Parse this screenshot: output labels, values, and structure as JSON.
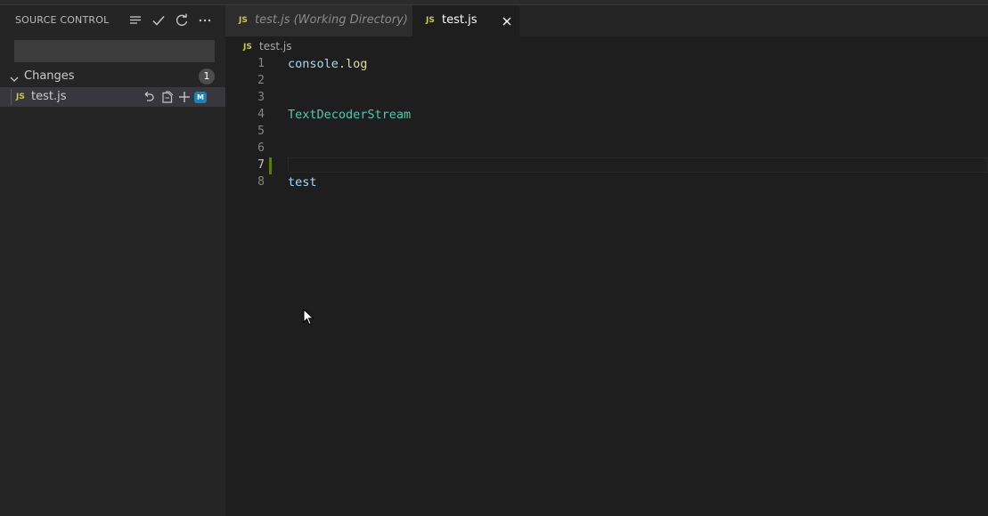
{
  "sidebar": {
    "title": "SOURCE CONTROL",
    "commit_placeholder": "",
    "changes": {
      "label": "Changes",
      "count": "1",
      "files": [
        {
          "icon": "JS",
          "name": "test.js",
          "status": "M"
        }
      ]
    },
    "header_icons": [
      "view-as-tree-icon",
      "commit-check-icon",
      "refresh-icon",
      "more-actions-icon"
    ],
    "row_icons": [
      "discard-changes-icon",
      "open-file-icon",
      "stage-changes-icon"
    ]
  },
  "tabs": [
    {
      "icon": "JS",
      "label": "test.js (Working Directory)",
      "active": false
    },
    {
      "icon": "JS",
      "label": "test.js",
      "active": true
    }
  ],
  "breadcrumb": {
    "icon": "JS",
    "file": "test.js"
  },
  "editor": {
    "lines": [
      {
        "num": "1",
        "ident": "console",
        "punct": ".",
        "func": "log",
        "type": ""
      },
      {
        "num": "2",
        "ident": "",
        "punct": "",
        "func": "",
        "type": ""
      },
      {
        "num": "3",
        "ident": "",
        "punct": "",
        "func": "",
        "type": ""
      },
      {
        "num": "4",
        "ident": "",
        "punct": "",
        "func": "",
        "type": "TextDecoderStream"
      },
      {
        "num": "5",
        "ident": "",
        "punct": "",
        "func": "",
        "type": ""
      },
      {
        "num": "6",
        "ident": "",
        "punct": "",
        "func": "",
        "type": ""
      },
      {
        "num": "7",
        "ident": "",
        "punct": "",
        "func": "",
        "type": ""
      },
      {
        "num": "8",
        "ident": "test",
        "punct": "",
        "func": "",
        "type": ""
      }
    ],
    "active_line": "7"
  },
  "colors": {
    "js_icon": "#cbcb41",
    "modified_badge": "#1b80b2",
    "gutter_modified": "#587c0c"
  }
}
